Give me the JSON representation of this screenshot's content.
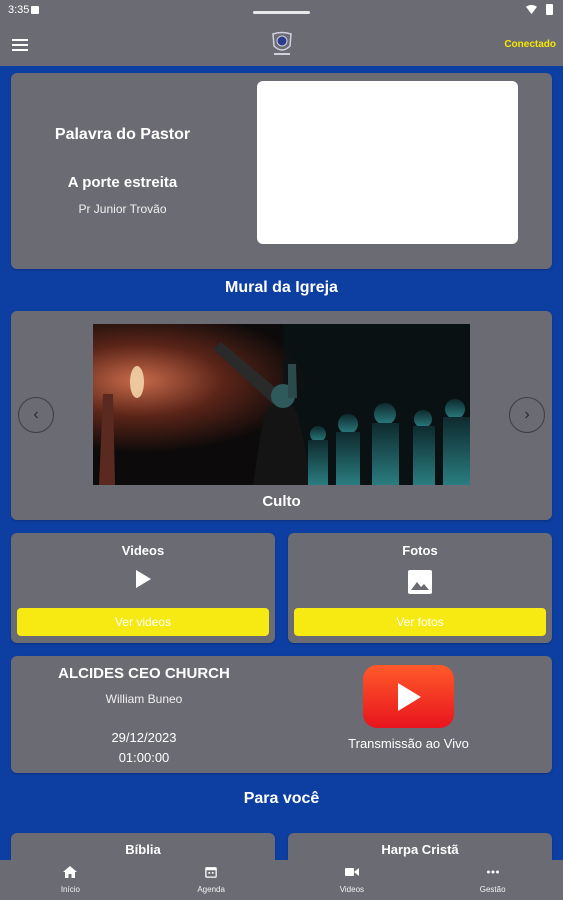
{
  "status_bar": {
    "time": "3:35"
  },
  "top_bar": {
    "connection_status": "Conectado"
  },
  "pastor_word": {
    "heading": "Palavra do Pastor",
    "title": "A porte estreita",
    "author": "Pr Junior Trovão"
  },
  "mural": {
    "section_title": "Mural da Igreja",
    "caption": "Culto"
  },
  "videos": {
    "label": "Videos",
    "button_label": "Ver videos"
  },
  "photos": {
    "label": "Fotos",
    "button_label": "Ver fotos"
  },
  "live": {
    "title": "ALCIDES CEO CHURCH",
    "pastor": "William Buneo",
    "date": "29/12/2023",
    "time": "01:00:00",
    "caption": "Transmissão ao Vivo"
  },
  "for_you": {
    "section_title": "Para você",
    "items": [
      {
        "label": "Bíblia"
      },
      {
        "label": "Harpa Cristã"
      }
    ]
  },
  "bottom_nav": {
    "items": [
      {
        "label": "Início",
        "icon": "home-icon"
      },
      {
        "label": "Agenda",
        "icon": "calendar-icon"
      },
      {
        "label": "Videos",
        "icon": "video-camera-icon"
      },
      {
        "label": "Gestão",
        "icon": "more-horizontal-icon"
      }
    ]
  },
  "colors": {
    "background": "#0d3fa3",
    "card": "#6b6b73",
    "accent_yellow": "#f7ea12",
    "youtube_red": "#e8141d"
  }
}
